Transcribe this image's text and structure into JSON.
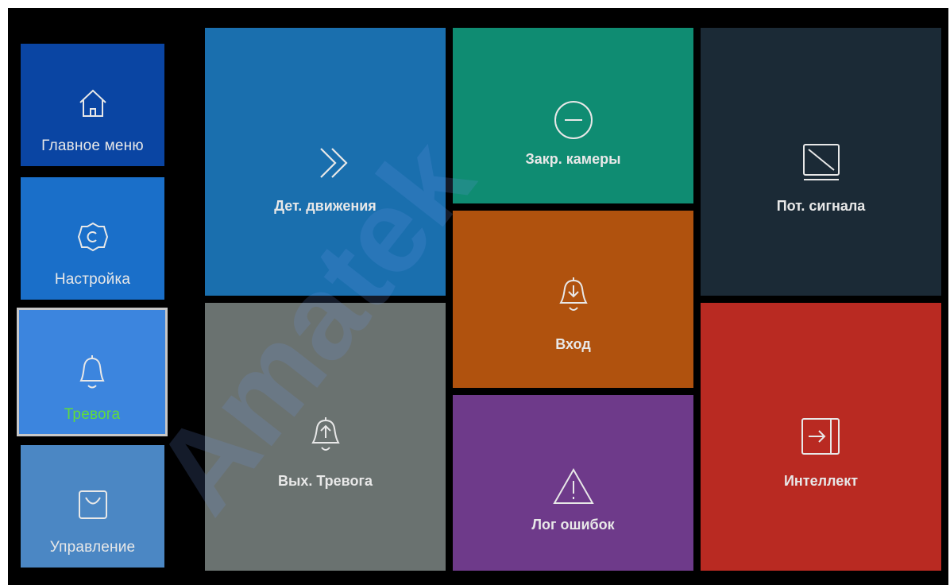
{
  "sidebar": {
    "items": [
      {
        "label": "Главное меню",
        "color": "#0a45a3",
        "icon": "home-icon",
        "selected": false
      },
      {
        "label": "Настройка",
        "color": "#1a6fc9",
        "icon": "gear-icon",
        "selected": false
      },
      {
        "label": "Тревога",
        "color": "#3c85de",
        "icon": "bell-icon",
        "selected": true,
        "label_color": "#5fdc3c"
      },
      {
        "label": "Управление",
        "color": "#4b87c4",
        "icon": "bag-icon",
        "selected": false
      }
    ]
  },
  "tiles": {
    "motion": {
      "label": "Дет. движения",
      "color": "#1a6fae",
      "icon": "double-chevron-icon"
    },
    "tamper": {
      "label": "Закр. камеры",
      "color": "#0f8c72",
      "icon": "minus-circle-icon"
    },
    "video_loss": {
      "label": "Пот. сигнала",
      "color": "#1b2a36",
      "icon": "no-signal-icon"
    },
    "input": {
      "label": "Вход",
      "color": "#b0520e",
      "icon": "bell-in-icon"
    },
    "output": {
      "label": "Вых. Тревога",
      "color": "#6a7270",
      "icon": "bell-out-icon"
    },
    "error_log": {
      "label": "Лог ошибок",
      "color": "#6e3a8a",
      "icon": "warning-icon"
    },
    "intelligent": {
      "label": "Интеллект",
      "color": "#b92a22",
      "icon": "enter-icon"
    }
  },
  "watermark": "Amatek"
}
